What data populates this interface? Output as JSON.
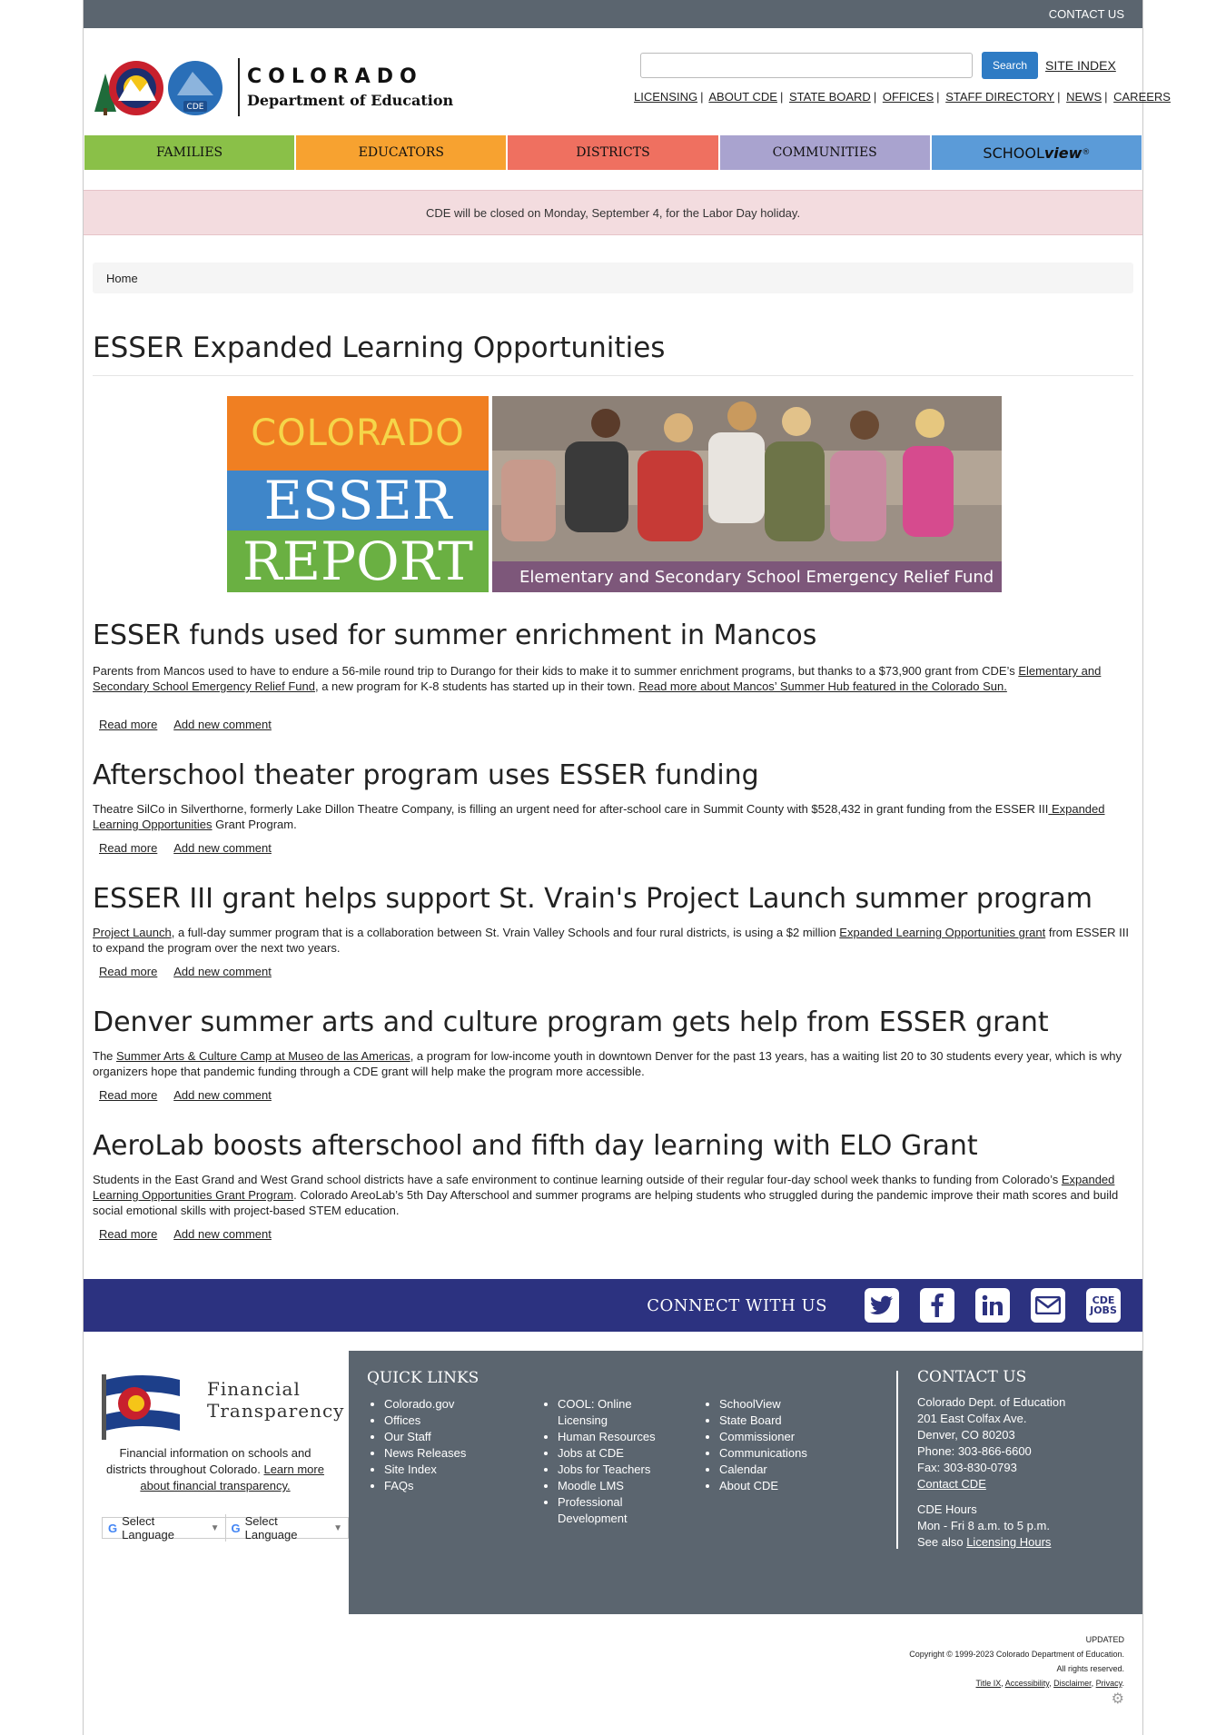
{
  "topbar": {
    "contact": "CONTACT US"
  },
  "logo": {
    "line1": "COLORADO",
    "line2": "Department of Education",
    "badge": "CDE"
  },
  "search": {
    "placeholder": "",
    "button": "Search",
    "site_index": "SITE INDEX"
  },
  "header_links": [
    "LICENSING",
    "ABOUT CDE",
    "STATE BOARD",
    "OFFICES",
    "STAFF DIRECTORY",
    "NEWS",
    "CAREERS"
  ],
  "nav": {
    "families": "FAMILIES",
    "educators": "EDUCATORS",
    "districts": "DISTRICTS",
    "communities": "COMMUNITIES",
    "schoolview_a": "SCHOOL",
    "schoolview_b": "view"
  },
  "alert": "CDE will be closed on Monday, September 4, for the Labor Day holiday.",
  "breadcrumb": "Home",
  "page_title": "ESSER Expanded Learning Opportunities",
  "banner": {
    "l1": "COLORADO",
    "l2": "ESSER",
    "l3": "REPORT",
    "caption": "Elementary and Secondary School Emergency Relief Fund"
  },
  "articles": [
    {
      "title": "ESSER funds used for summer enrichment in Mancos",
      "p1": " Parents from Mancos used to have to endure a 56-mile round trip to Durango for their kids to make it to summer enrichment programs, but thanks to a $73,900 grant from CDE’s ",
      "link1": "Elementary and Secondary School Emergency Relief Fund",
      "p2": ", a new program for K-8 students has started up in their town. ",
      "link2": "Read more about Mancos’ Summer Hub featured in the Colorado Sun."
    },
    {
      "title": "Afterschool theater program uses ESSER funding",
      "p1": "Theatre SilCo in Silverthorne, formerly Lake Dillon Theatre Company, is filling an urgent need for after-school care in Summit County with $528,432 in grant funding from the ESSER III",
      "link1": " Expanded Learning Opportunities",
      "p2": " Grant Program."
    },
    {
      "title": "ESSER III grant helps support St. Vrain's Project Launch summer program",
      "link1": "Project Launch",
      "p1": ", a full-day summer program that is a collaboration between St. Vrain Valley Schools and four rural districts, is using a $2 million ",
      "link2": "Expanded Learning Opportunities grant",
      "p2": " from ESSER III to expand the program over the next two years."
    },
    {
      "title": "Denver summer arts and culture program gets help from ESSER grant",
      "p1": "The ",
      "link1": "Summer Arts & Culture Camp at Museo de las Americas",
      "p2": ", a program for low-income youth in downtown Denver for the past 13 years, has a waiting list 20 to 30 students every year, which is why organizers hope that pandemic funding through a CDE grant will help make the program more accessible."
    },
    {
      "title": "AeroLab boosts afterschool and fifth day learning with ELO Grant",
      "p1": "Students in the East Grand and West Grand school districts have a safe environment to continue learning outside of their regular four-day school week thanks to funding from Colorado’s ",
      "link1": "Expanded Learning Opportunities Grant Program",
      "p2": ". Colorado AreoLab’s 5th Day Afterschool and summer programs are helping students who struggled during the pandemic improve their math scores and build social emotional skills with project-based STEM education."
    }
  ],
  "article_actions": {
    "read_more": "Read more",
    "add_comment": "Add new comment"
  },
  "connect": {
    "label": "CONNECT WITH US",
    "jobs_l1": "CDE",
    "jobs_l2": "JOBS"
  },
  "financial": {
    "title1": "Financial",
    "title2": "Transparency",
    "desc": "Financial information on schools and districts throughout Colorado. ",
    "link": "Learn more about financial transparency."
  },
  "language": {
    "label": "Select Language"
  },
  "quick_links": {
    "title": "QUICK LINKS",
    "col1": [
      "Colorado.gov",
      "Offices",
      "Our Staff",
      "News Releases",
      "Site Index",
      "FAQs"
    ],
    "col2": [
      "COOL: Online Licensing",
      "Human Resources",
      "Jobs at CDE",
      "Jobs for Teachers",
      "Moodle LMS",
      "Professional Development"
    ],
    "col3": [
      "SchoolView",
      "State Board",
      "Commissioner",
      "Communications",
      "Calendar",
      "About CDE"
    ]
  },
  "contact": {
    "title": "CONTACT US",
    "lines": [
      "Colorado Dept. of Education",
      "201 East Colfax Ave.",
      "Denver, CO 80203",
      "Phone: 303-866-6600",
      "Fax: 303-830-0793"
    ],
    "contact_link": "Contact CDE",
    "hours_title": "CDE Hours",
    "hours": "Mon - Fri 8 a.m. to 5 p.m.",
    "see_also": "See also ",
    "licensing_hours": "Licensing Hours"
  },
  "copyright": {
    "updated": "UPDATED",
    "line1": "Copyright © 1999-2023 Colorado Department of Education.",
    "line2": "All rights reserved.",
    "links": [
      "Title IX",
      "Accessibility",
      "Disclaimer",
      "Privacy"
    ]
  }
}
